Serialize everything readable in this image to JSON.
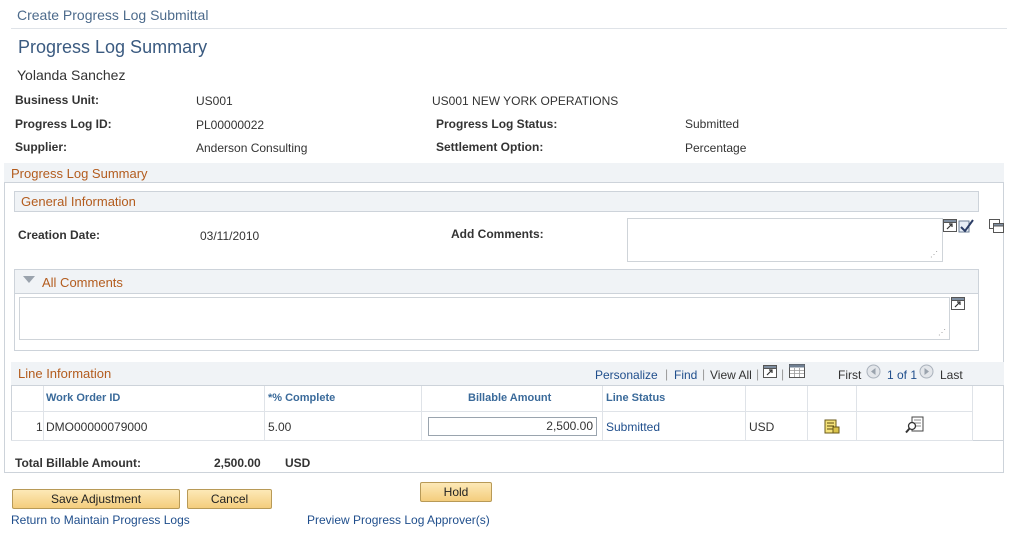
{
  "breadcrumb": "Create Progress Log Submittal",
  "page_title": "Progress Log Summary",
  "user_name": "Yolanda Sanchez",
  "header": {
    "business_unit_label": "Business Unit:",
    "business_unit": "US001",
    "business_unit_desc": "US001 NEW YORK OPERATIONS",
    "progress_log_id_label": "Progress Log ID:",
    "progress_log_id": "PL00000022",
    "status_label": "Progress Log Status:",
    "status": "Submitted",
    "supplier_label": "Supplier:",
    "supplier": "Anderson Consulting",
    "settlement_label": "Settlement Option:",
    "settlement": "Percentage"
  },
  "summary_box": {
    "title": "Progress Log Summary",
    "general_info": {
      "title": "General Information",
      "creation_date_label": "Creation Date:",
      "creation_date": "03/11/2010",
      "add_comments_label": "Add Comments:",
      "add_comments_value": ""
    },
    "all_comments": {
      "title": "All Comments",
      "value": ""
    }
  },
  "line_info": {
    "title": "Line Information",
    "toolbar": {
      "personalize": "Personalize",
      "find": "Find",
      "view_all": "View All",
      "first": "First",
      "range": "1 of 1",
      "last": "Last"
    },
    "columns": {
      "work_order": "Work Order ID",
      "complete": "*% Complete",
      "billable": "Billable Amount",
      "line_status": "Line Status"
    },
    "rows": [
      {
        "num": "1",
        "work_order": "DMO00000079000",
        "complete": "5.00",
        "billable": "2,500.00",
        "line_status": "Submitted",
        "currency": "USD"
      }
    ]
  },
  "totals": {
    "label": "Total Billable Amount:",
    "amount": "2,500.00",
    "currency": "USD"
  },
  "buttons": {
    "save": "Save Adjustment",
    "cancel": "Cancel",
    "hold": "Hold"
  },
  "links": {
    "return": "Return to Maintain Progress Logs",
    "preview": "Preview Progress Log Approver(s)"
  }
}
